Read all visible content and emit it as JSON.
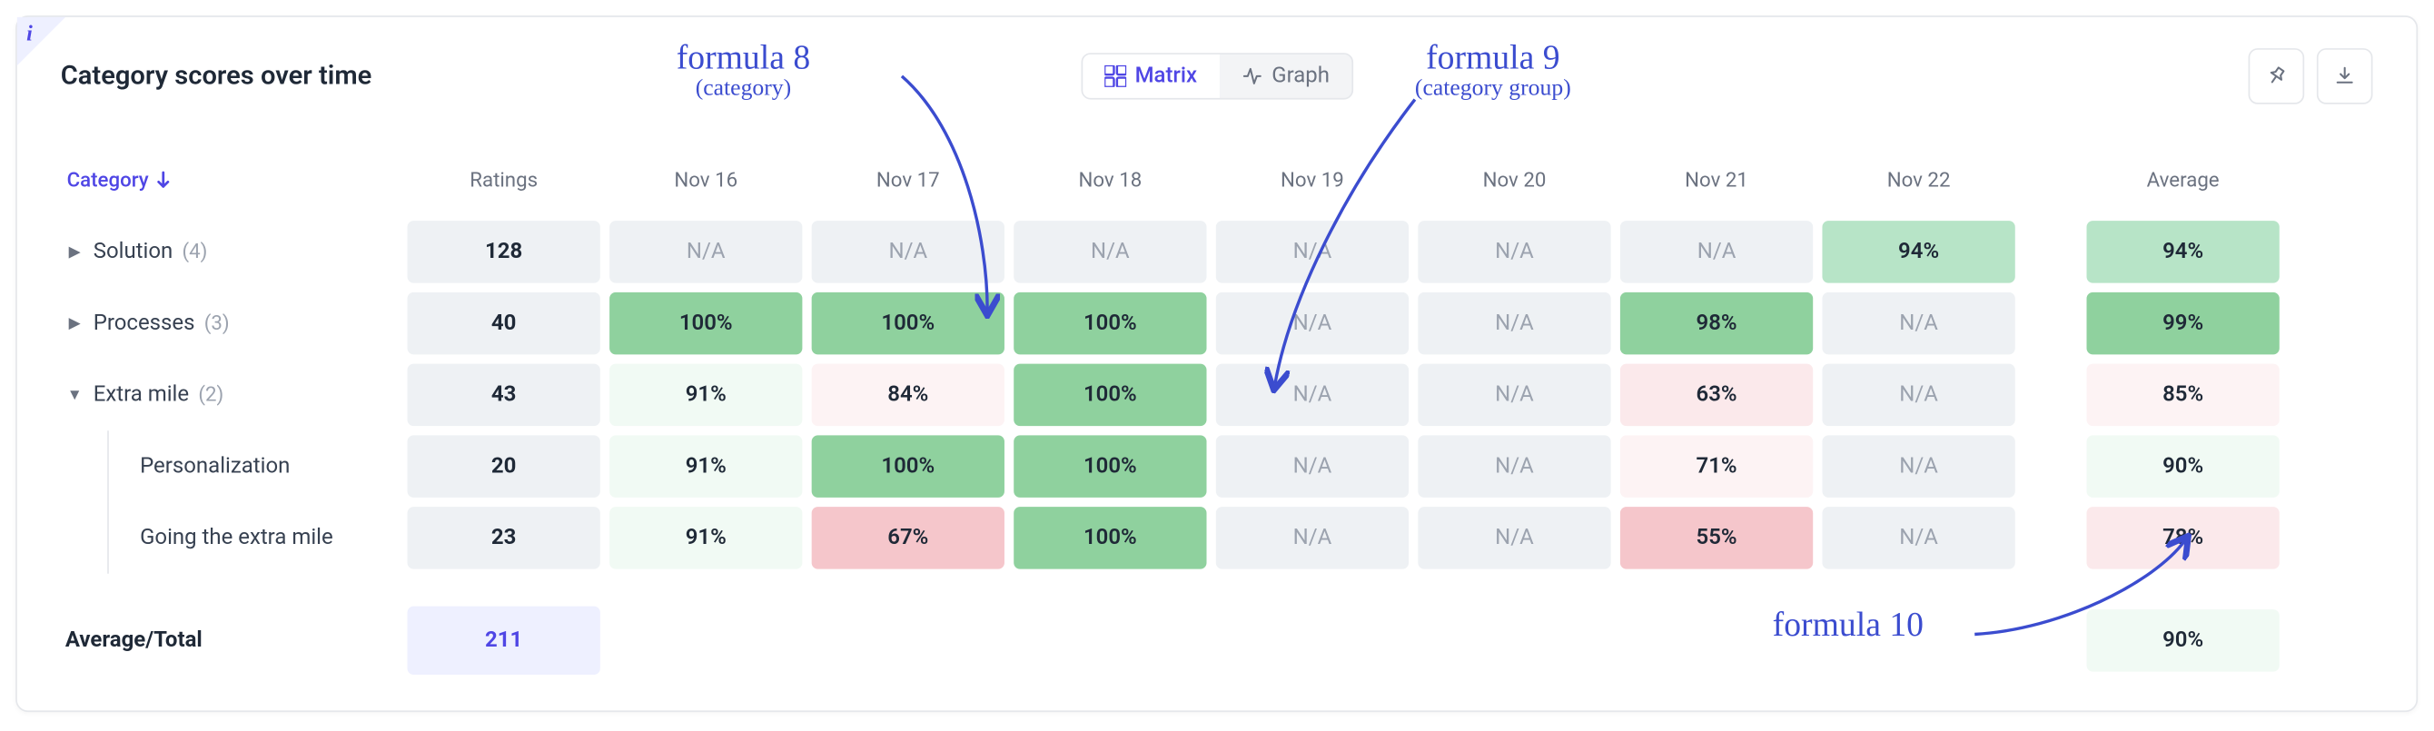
{
  "title": "Category scores over time",
  "toggle": {
    "matrix": "Matrix",
    "graph": "Graph"
  },
  "columns": {
    "category": "Category",
    "ratings": "Ratings",
    "dates": [
      "Nov 16",
      "Nov 17",
      "Nov 18",
      "Nov 19",
      "Nov 20",
      "Nov 21",
      "Nov 22"
    ],
    "average": "Average"
  },
  "rows": [
    {
      "label": "Solution",
      "count": "(4)",
      "expanded": false,
      "ratings": "128",
      "cells": [
        {
          "v": "N/A",
          "c": "na"
        },
        {
          "v": "N/A",
          "c": "na"
        },
        {
          "v": "N/A",
          "c": "na"
        },
        {
          "v": "N/A",
          "c": "na"
        },
        {
          "v": "N/A",
          "c": "na"
        },
        {
          "v": "N/A",
          "c": "na"
        },
        {
          "v": "94%",
          "c": "g-med"
        }
      ],
      "avg": {
        "v": "94%",
        "c": "g-med"
      }
    },
    {
      "label": "Processes",
      "count": "(3)",
      "expanded": false,
      "ratings": "40",
      "cells": [
        {
          "v": "100%",
          "c": "g-dark"
        },
        {
          "v": "100%",
          "c": "g-dark"
        },
        {
          "v": "100%",
          "c": "g-dark"
        },
        {
          "v": "N/A",
          "c": "na"
        },
        {
          "v": "N/A",
          "c": "na"
        },
        {
          "v": "98%",
          "c": "g-dark"
        },
        {
          "v": "N/A",
          "c": "na"
        }
      ],
      "avg": {
        "v": "99%",
        "c": "g-dark"
      }
    },
    {
      "label": "Extra mile",
      "count": "(2)",
      "expanded": true,
      "ratings": "43",
      "cells": [
        {
          "v": "91%",
          "c": "g-vlight"
        },
        {
          "v": "84%",
          "c": "r-vlight"
        },
        {
          "v": "100%",
          "c": "g-dark"
        },
        {
          "v": "N/A",
          "c": "na"
        },
        {
          "v": "N/A",
          "c": "na"
        },
        {
          "v": "63%",
          "c": "r-light"
        },
        {
          "v": "N/A",
          "c": "na"
        }
      ],
      "avg": {
        "v": "85%",
        "c": "r-vlight"
      },
      "children": [
        {
          "label": "Personalization",
          "ratings": "20",
          "cells": [
            {
              "v": "91%",
              "c": "g-vlight"
            },
            {
              "v": "100%",
              "c": "g-dark"
            },
            {
              "v": "100%",
              "c": "g-dark"
            },
            {
              "v": "N/A",
              "c": "na"
            },
            {
              "v": "N/A",
              "c": "na"
            },
            {
              "v": "71%",
              "c": "r-vlight"
            },
            {
              "v": "N/A",
              "c": "na"
            }
          ],
          "avg": {
            "v": "90%",
            "c": "g-vlight"
          }
        },
        {
          "label": "Going the extra mile",
          "ratings": "23",
          "cells": [
            {
              "v": "91%",
              "c": "g-vlight"
            },
            {
              "v": "67%",
              "c": "r-med"
            },
            {
              "v": "100%",
              "c": "g-dark"
            },
            {
              "v": "N/A",
              "c": "na"
            },
            {
              "v": "N/A",
              "c": "na"
            },
            {
              "v": "55%",
              "c": "r-med"
            },
            {
              "v": "N/A",
              "c": "na"
            }
          ],
          "avg": {
            "v": "78%",
            "c": "r-light"
          }
        }
      ]
    }
  ],
  "footer": {
    "label": "Average/Total",
    "total": "211",
    "avg": {
      "v": "90%",
      "c": "g-vlight"
    }
  },
  "annotations": {
    "f8": {
      "title": "formula 8",
      "sub": "(category)"
    },
    "f9": {
      "title": "formula 9",
      "sub": "(category group)"
    },
    "f10": {
      "title": "formula 10"
    }
  }
}
